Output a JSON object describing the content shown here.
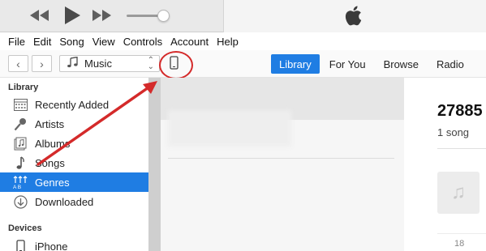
{
  "menu": [
    "File",
    "Edit",
    "Song",
    "View",
    "Controls",
    "Account",
    "Help"
  ],
  "toolbar": {
    "back_label": "‹",
    "forward_label": "›",
    "media_kind": "Music",
    "tabs": [
      {
        "label": "Library",
        "active": true
      },
      {
        "label": "For You",
        "active": false
      },
      {
        "label": "Browse",
        "active": false
      },
      {
        "label": "Radio",
        "active": false
      }
    ]
  },
  "sidebar": {
    "library_heading": "Library",
    "items": [
      {
        "label": "Recently Added",
        "icon": "recently-added-icon"
      },
      {
        "label": "Artists",
        "icon": "microphone-icon"
      },
      {
        "label": "Albums",
        "icon": "albums-icon"
      },
      {
        "label": "Songs",
        "icon": "music-note-icon"
      },
      {
        "label": "Genres",
        "icon": "genres-icon",
        "selected": true
      },
      {
        "label": "Downloaded",
        "icon": "download-icon"
      }
    ],
    "devices_heading": "Devices",
    "devices": [
      {
        "label": "iPhone",
        "icon": "iphone-icon"
      }
    ]
  },
  "detail": {
    "title": "27885",
    "song_count": "1 song",
    "track_number": "18"
  },
  "colors": {
    "accent": "#1f7de3",
    "annotation": "#d42a2a"
  }
}
